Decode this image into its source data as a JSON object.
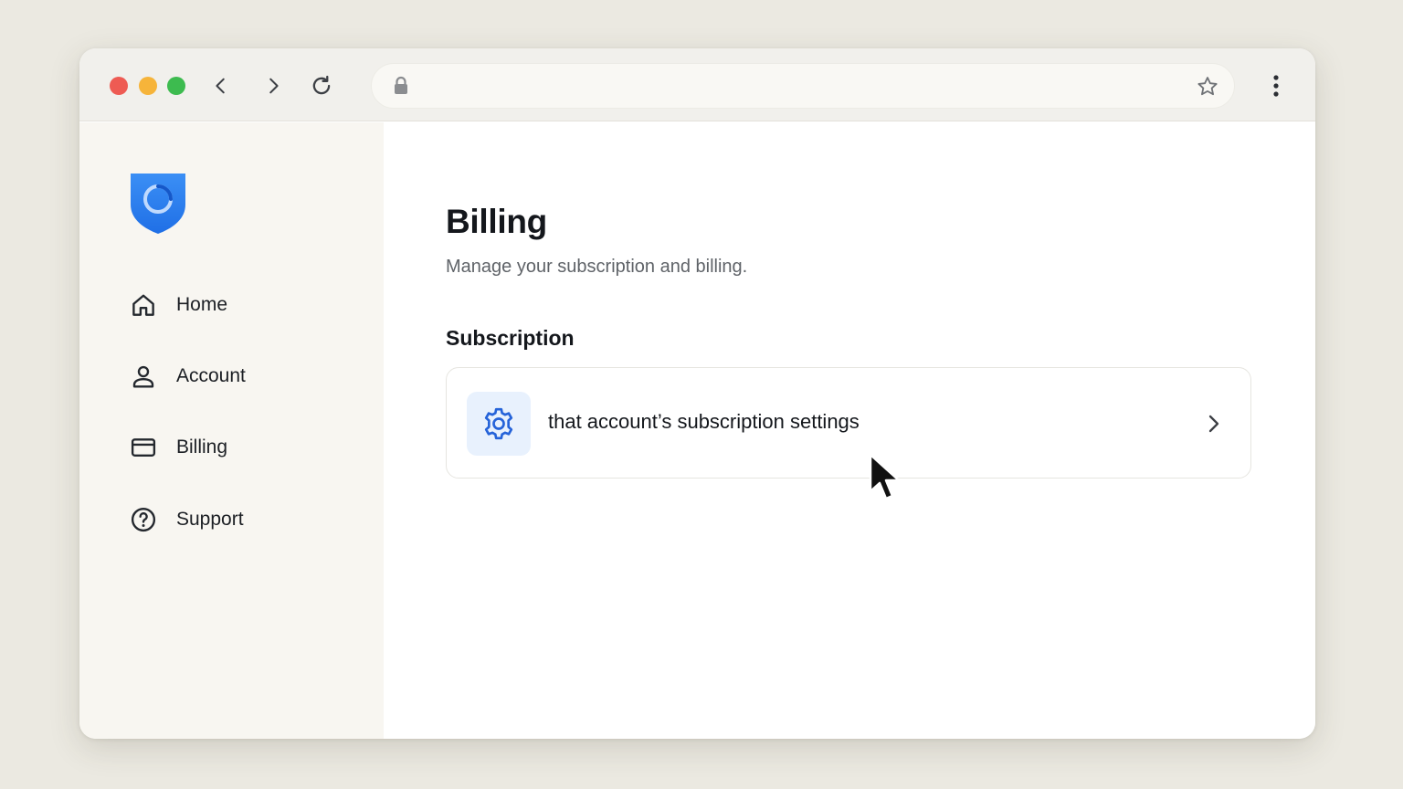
{
  "browser": {
    "url": "",
    "icons": [
      "back-icon",
      "forward-icon",
      "reload-icon",
      "lock-icon",
      "star-icon",
      "kebab-menu-icon"
    ]
  },
  "sidebar": {
    "logo": "shield-logo",
    "items": [
      {
        "label": "Home",
        "icon": "home-icon"
      },
      {
        "label": "Account",
        "icon": "user-icon"
      },
      {
        "label": "Billing",
        "icon": "credit-card-icon"
      },
      {
        "label": "Support",
        "icon": "help-circle-icon"
      }
    ]
  },
  "main": {
    "title": "Billing",
    "subtitle": "Manage your subscription and billing.",
    "section_title": "Subscription",
    "card": {
      "label": "that account’s subscription settings",
      "icon": "gear-icon",
      "trailing_icon": "chevron-right-icon"
    }
  },
  "colors": {
    "accent": "#2563d9",
    "icon_tint_bg": "#e8f1fd",
    "sidebar_bg": "#f8f6f1",
    "toolbar_bg": "#f1f0ec",
    "page_bg": "#ebe9e1"
  }
}
